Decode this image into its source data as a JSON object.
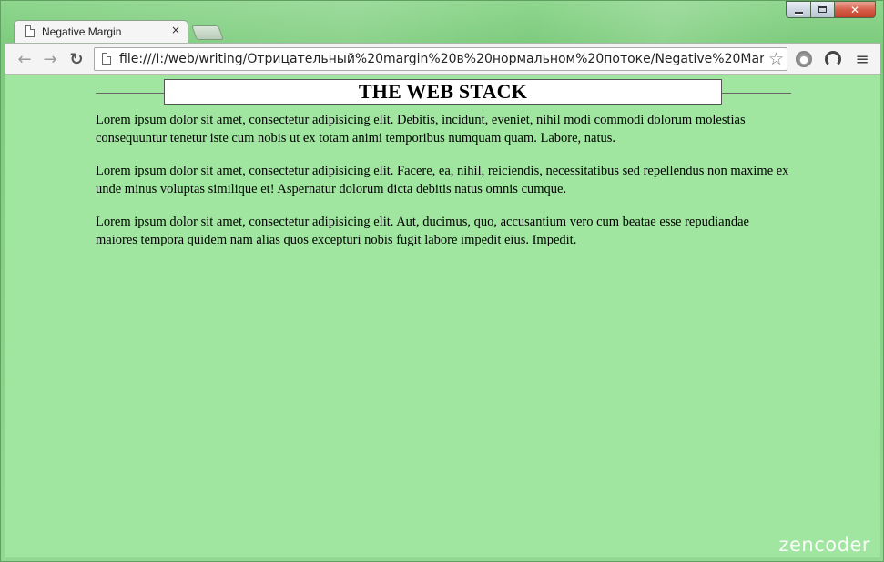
{
  "browser": {
    "tab_title": "Negative Margin",
    "tab_close_glyph": "×",
    "address": "file:///I:/web/writing/Отрицательный%20margin%20в%20нормальном%20потоке/Negative%20Mar",
    "icons": {
      "back": "back-arrow-icon",
      "forward": "forward-arrow-icon",
      "reload": "reload-icon",
      "page": "page-icon",
      "star": "star-icon",
      "menu": "hamburger-menu-icon"
    }
  },
  "page": {
    "heading": "THE WEB STACK",
    "paragraphs": [
      "Lorem ipsum dolor sit amet, consectetur adipisicing elit. Debitis, incidunt, eveniet, nihil modi commodi dolorum molestias consequuntur tenetur iste cum nobis ut ex totam animi temporibus numquam quam. Labore, natus.",
      "Lorem ipsum dolor sit amet, consectetur adipisicing elit. Facere, ea, nihil, reiciendis, necessitatibus sed repellendus non maxime ex unde minus voluptas similique et! Aspernatur dolorum dicta debitis natus omnis cumque.",
      "Lorem ipsum dolor sit amet, consectetur adipisicing elit. Aut, ducimus, quo, accusantium vero cum beatae esse repudiandae maiores tempora quidem nam alias quos excepturi nobis fugit labore impedit eius. Impedit."
    ],
    "background_color": "#a0e5a0"
  },
  "watermark": "zencoder"
}
